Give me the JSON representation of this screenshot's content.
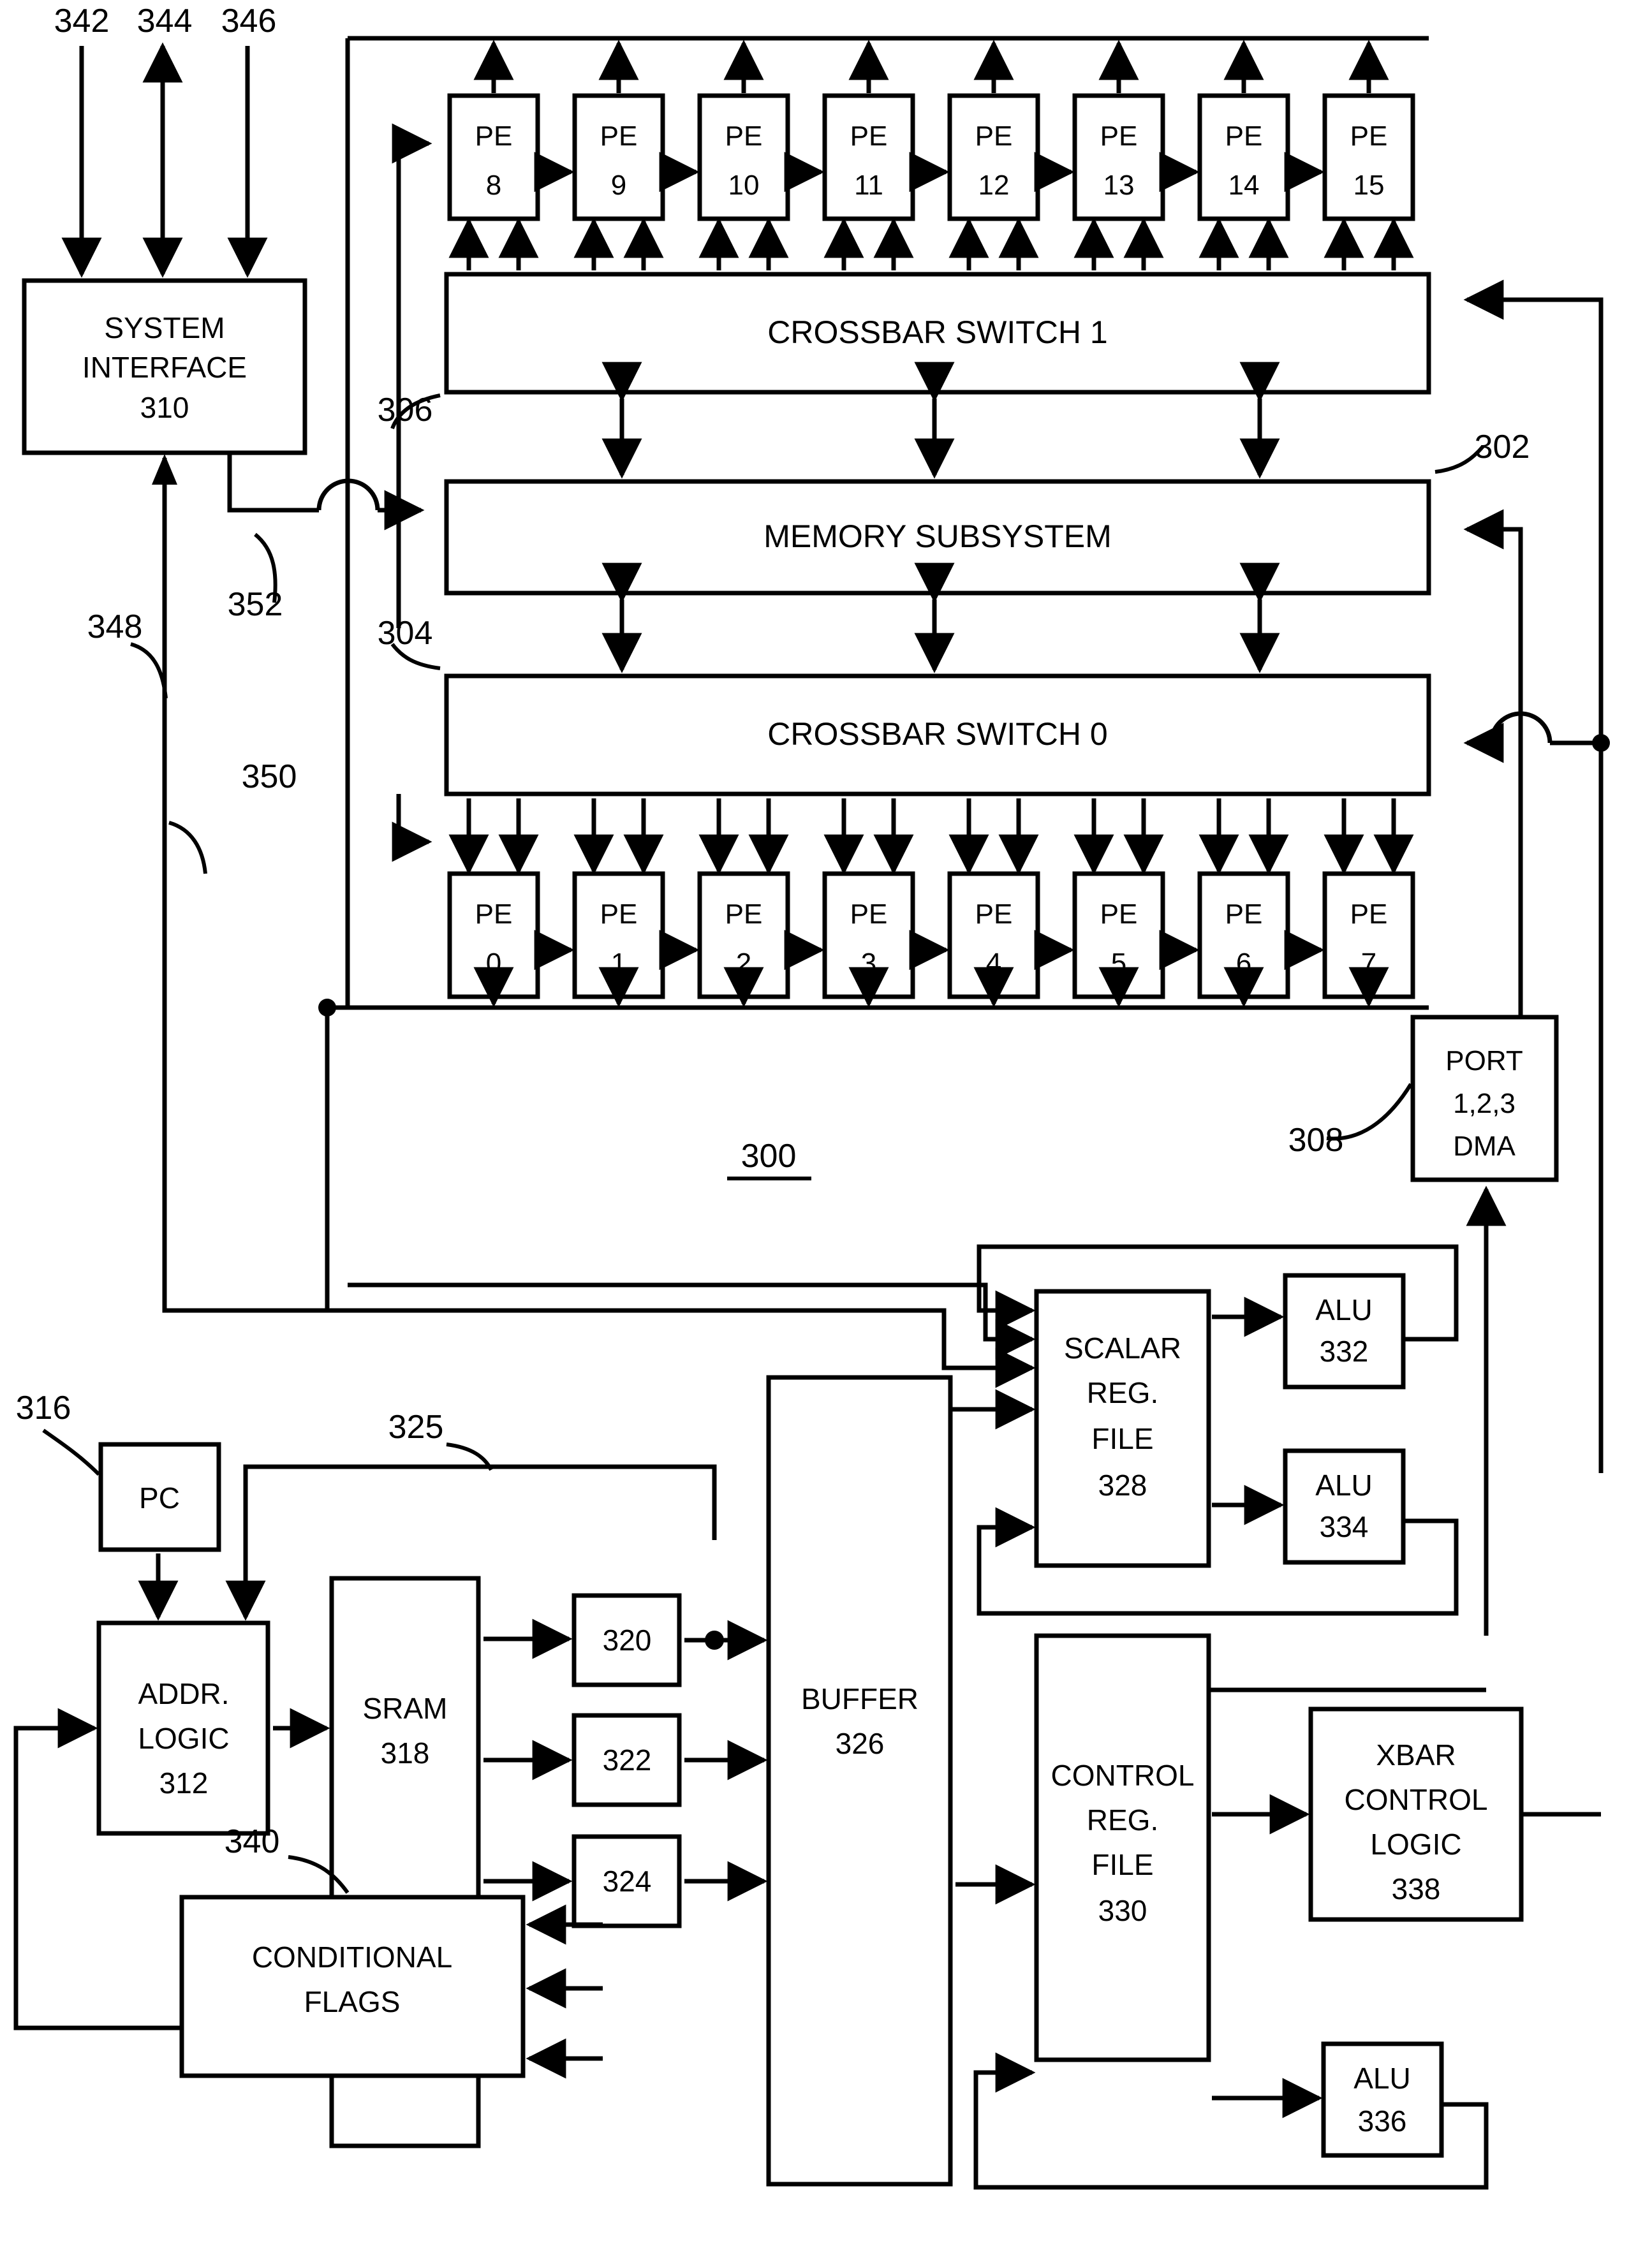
{
  "figure": {
    "ref_main": "300",
    "labels": {
      "memory_subsystem": "MEMORY SUBSYSTEM",
      "crossbar1": "CROSSBAR SWITCH 1",
      "crossbar0": "CROSSBAR SWITCH 0",
      "system_interface_l1": "SYSTEM",
      "system_interface_l2": "INTERFACE",
      "system_interface_ref": "310",
      "port_dma_l1": "PORT",
      "port_dma_l2": "1,2,3",
      "port_dma_l3": "DMA",
      "pc": "PC",
      "addr_logic_l1": "ADDR.",
      "addr_logic_l2": "LOGIC",
      "addr_logic_ref": "312",
      "sram_l1": "SRAM",
      "sram_ref": "318",
      "reg320": "320",
      "reg322": "322",
      "reg324": "324",
      "buffer_l1": "BUFFER",
      "buffer_ref": "326",
      "scalar_l1": "SCALAR",
      "scalar_l2": "REG.",
      "scalar_l3": "FILE",
      "scalar_ref": "328",
      "control_l1": "CONTROL",
      "control_l2": "REG.",
      "control_l3": "FILE",
      "control_ref": "330",
      "alu332_l1": "ALU",
      "alu332_ref": "332",
      "alu334_l1": "ALU",
      "alu334_ref": "334",
      "alu336_l1": "ALU",
      "alu336_ref": "336",
      "xbar_l1": "XBAR",
      "xbar_l2": "CONTROL",
      "xbar_l3": "LOGIC",
      "xbar_ref": "338",
      "cond_l1": "CONDITIONAL",
      "cond_l2": "FLAGS"
    },
    "reference_numerals": {
      "n342": "342",
      "n344": "344",
      "n346": "346",
      "n348": "348",
      "n350": "350",
      "n352": "352",
      "n302": "302",
      "n304": "304",
      "n306": "306",
      "n308": "308",
      "n316": "316",
      "n325": "325",
      "n340": "340",
      "n300": "300"
    },
    "pe_row_top": [
      {
        "name": "PE",
        "num": "8"
      },
      {
        "name": "PE",
        "num": "9"
      },
      {
        "name": "PE",
        "num": "10"
      },
      {
        "name": "PE",
        "num": "11"
      },
      {
        "name": "PE",
        "num": "12"
      },
      {
        "name": "PE",
        "num": "13"
      },
      {
        "name": "PE",
        "num": "14"
      },
      {
        "name": "PE",
        "num": "15"
      }
    ],
    "pe_row_bottom": [
      {
        "name": "PE",
        "num": "0"
      },
      {
        "name": "PE",
        "num": "1"
      },
      {
        "name": "PE",
        "num": "2"
      },
      {
        "name": "PE",
        "num": "3"
      },
      {
        "name": "PE",
        "num": "4"
      },
      {
        "name": "PE",
        "num": "5"
      },
      {
        "name": "PE",
        "num": "6"
      },
      {
        "name": "PE",
        "num": "7"
      }
    ],
    "colors": {
      "ink": "#000000",
      "paper": "#ffffff"
    }
  }
}
